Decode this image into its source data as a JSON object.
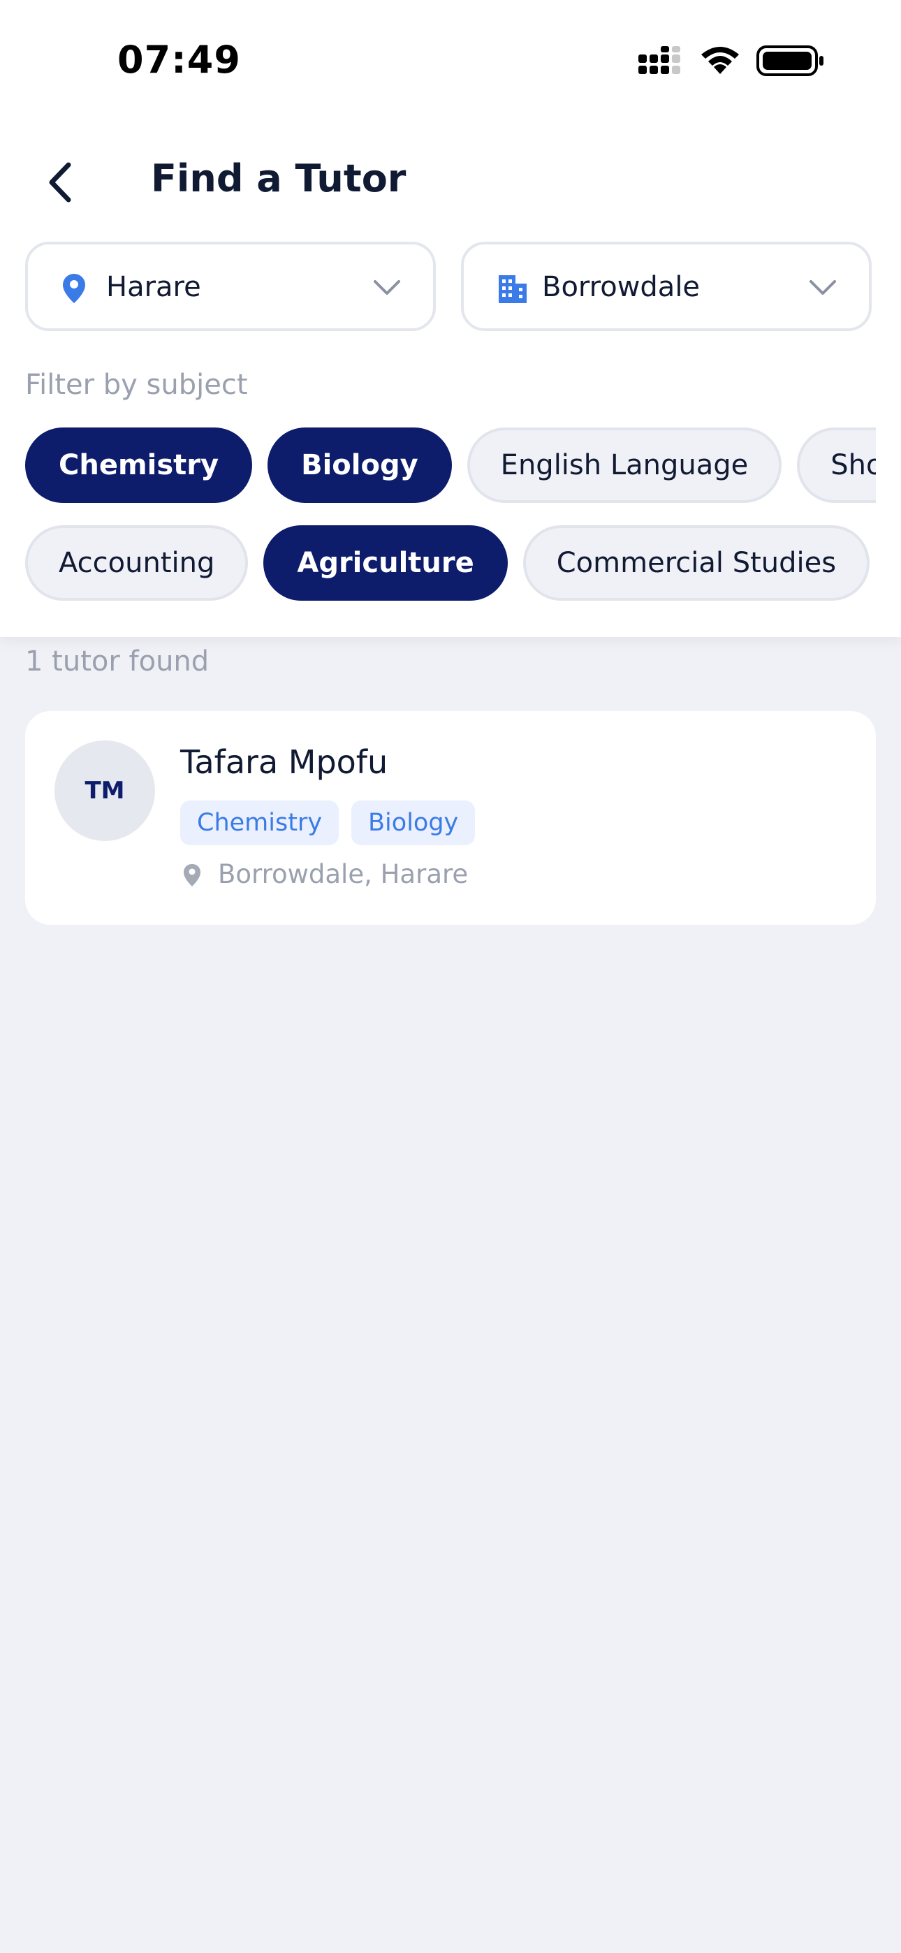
{
  "status_bar": {
    "time": "07:49",
    "icons": [
      "signal-icon",
      "wifi-icon",
      "battery-icon"
    ]
  },
  "header": {
    "back_icon": "chevron-left-icon",
    "title": "Find a Tutor"
  },
  "filters": {
    "city": {
      "icon": "location-pin-icon",
      "value": "Harare",
      "chevron": "chevron-down-icon"
    },
    "area": {
      "icon": "building-icon",
      "value": "Borrowdale",
      "chevron": "chevron-down-icon"
    },
    "subject_label": "Filter by subject",
    "subjects_row1": [
      {
        "label": "Chemistry",
        "selected": true
      },
      {
        "label": "Biology",
        "selected": true
      },
      {
        "label": "English Language",
        "selected": false
      },
      {
        "label": "Shona",
        "selected": false
      }
    ],
    "subjects_row2": [
      {
        "label": "Accounting",
        "selected": false
      },
      {
        "label": "Agriculture",
        "selected": true
      },
      {
        "label": "Commercial Studies",
        "selected": false
      },
      {
        "label": "",
        "selected": false
      }
    ]
  },
  "results": {
    "count_text": "1 tutor found",
    "tutors": [
      {
        "initials": "TM",
        "name": "Tafara Mpofu",
        "subjects": [
          "Chemistry",
          "Biology"
        ],
        "location": "Borrowdale, Harare"
      }
    ]
  },
  "colors": {
    "accent_navy": "#0D1C6B",
    "accent_blue": "#3B7BE8",
    "background": "#F0F1F6"
  }
}
